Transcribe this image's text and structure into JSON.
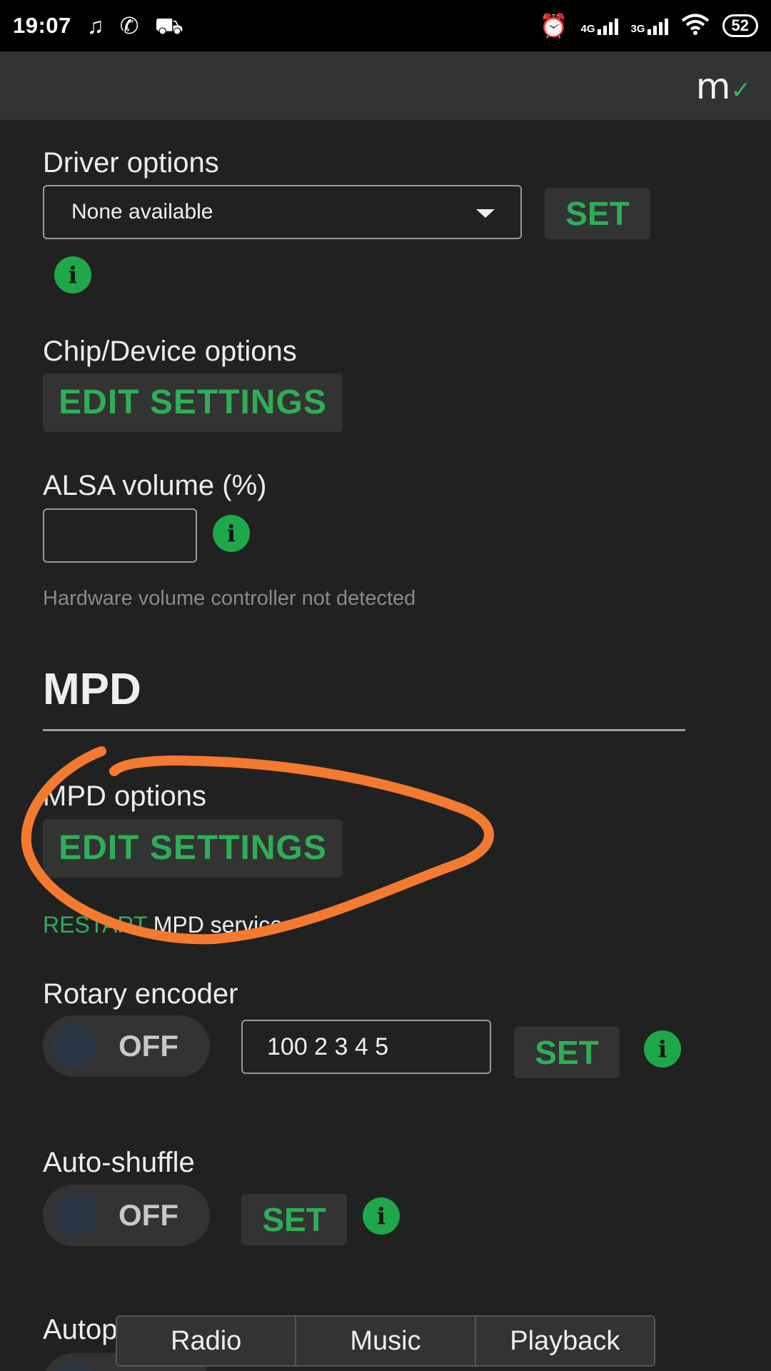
{
  "status_bar": {
    "time": "19:07",
    "icons_left": [
      "music-icon",
      "whatsapp-icon",
      "car-icon"
    ],
    "icons_right": [
      "alarm-icon",
      "signal-4g-icon",
      "signal-3g-icon",
      "wifi-icon"
    ],
    "net1": "4G",
    "net2": "3G",
    "battery": "52"
  },
  "header": {
    "logo": "m",
    "logo_mark": "✓"
  },
  "driver": {
    "label": "Driver options",
    "select_value": "None available",
    "set": "SET"
  },
  "chip": {
    "label": "Chip/Device options",
    "button": "EDIT SETTINGS"
  },
  "alsa": {
    "label": "ALSA volume (%)",
    "value": "",
    "note": "Hardware volume controller not detected"
  },
  "mpd": {
    "heading": "MPD",
    "options_label": "MPD options",
    "options_button": "EDIT SETTINGS",
    "restart_link": "RESTART",
    "restart_text": " MPD service"
  },
  "rotary": {
    "label": "Rotary encoder",
    "toggle": "OFF",
    "value": "100 2 3 4 5",
    "set": "SET"
  },
  "autoshuffle": {
    "label": "Auto-shuffle",
    "toggle": "OFF",
    "set": "SET"
  },
  "autoplay": {
    "label": "Autoplay"
  },
  "info_glyph": "i",
  "bottom_nav": [
    "Radio",
    "Music",
    "Playback"
  ],
  "colors": {
    "accent": "#2eaf56",
    "background": "#212121",
    "annotation": "#f47a30"
  }
}
